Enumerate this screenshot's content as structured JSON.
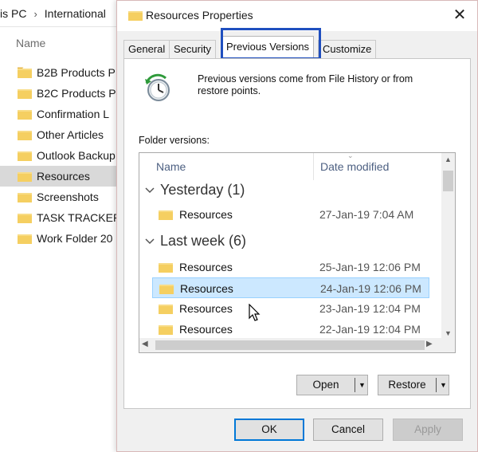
{
  "explorer": {
    "breadcrumb": [
      "is PC",
      "International"
    ],
    "breadcrumb_separator": "›",
    "column_name": "Name",
    "items": [
      {
        "label": "B2B Products P"
      },
      {
        "label": "B2C Products P"
      },
      {
        "label": "Confirmation L"
      },
      {
        "label": "Other Articles"
      },
      {
        "label": "Outlook Backup"
      },
      {
        "label": "Resources",
        "selected": true
      },
      {
        "label": "Screenshots"
      },
      {
        "label": "TASK TRACKER"
      },
      {
        "label": "Work Folder 20"
      }
    ]
  },
  "dialog": {
    "title": "Resources Properties",
    "close_glyph": "✕",
    "tabs": [
      {
        "label": "General"
      },
      {
        "label": "Security"
      },
      {
        "label": "Previous Versions",
        "active": true
      },
      {
        "label": "Customize"
      }
    ],
    "info_text": "Previous versions come from File History or from restore points.",
    "versions_label": "Folder versions:",
    "columns": {
      "name": "Name",
      "date": "Date modified"
    },
    "groups": [
      {
        "label": "Yesterday (1)"
      },
      {
        "label": "Last week (6)"
      }
    ],
    "rows": [
      {
        "name": "Resources",
        "date": "27-Jan-19 7:04 AM"
      },
      {
        "name": "Resources",
        "date": "25-Jan-19 12:06 PM"
      },
      {
        "name": "Resources",
        "date": "24-Jan-19 12:06 PM",
        "selected": true
      },
      {
        "name": "Resources",
        "date": "23-Jan-19 12:04 PM"
      },
      {
        "name": "Resources",
        "date": "22-Jan-19 12:04 PM"
      }
    ],
    "buttons": {
      "open": "Open",
      "restore": "Restore",
      "ok": "OK",
      "cancel": "Cancel",
      "apply": "Apply"
    },
    "colors": {
      "highlight_box": "#1f4fbf",
      "selection": "#cce8ff",
      "folder": "#f5cf61",
      "default_button_border": "#0078d7"
    },
    "icons": [
      "folder-icon",
      "file-history-clock-icon",
      "close-icon",
      "chevron-down-icon",
      "dropdown-arrow-icon",
      "mouse-cursor-icon"
    ]
  }
}
